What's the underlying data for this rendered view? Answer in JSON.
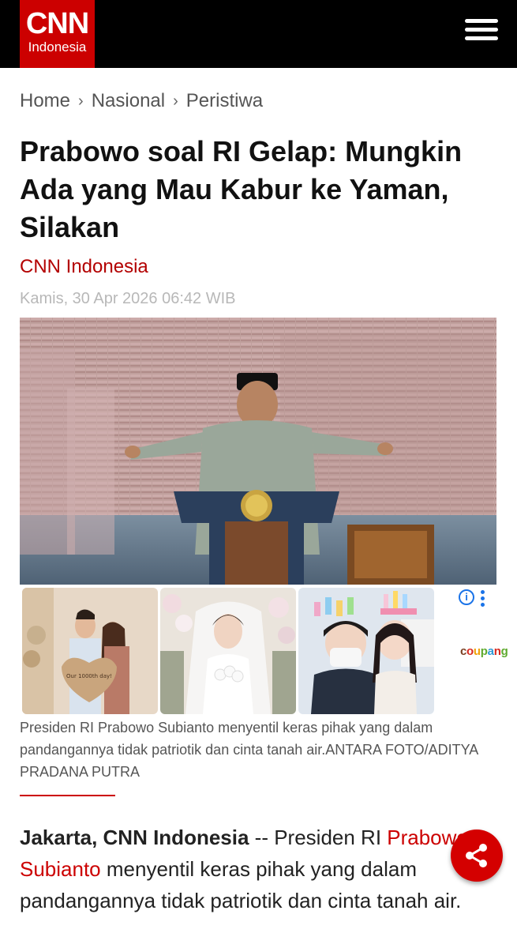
{
  "header": {
    "logo_main": "CNN",
    "logo_sub": "Indonesia",
    "menu_icon": "hamburger-menu-icon"
  },
  "breadcrumb": {
    "items": [
      "Home",
      "Nasional",
      "Peristiwa"
    ],
    "separator": "›"
  },
  "article": {
    "title": "Prabowo soal RI Gelap: Mungkin Ada yang Mau Kabur ke Yaman, Silakan",
    "author": "CNN Indonesia",
    "date": "Kamis, 30 Apr 2026 06:42 WIB",
    "caption": "Presiden RI Prabowo Subianto menyentil keras pihak yang dalam pandangannya tidak patriotik dan cinta tanah air.ANTARA FOTO/ADITYA PRADANA PUTRA",
    "lead_dateline": "Jakarta, CNN Indonesia",
    "lead_dash": " -- Presiden RI ",
    "lead_link": "Prabowo Subianto",
    "lead_rest": " menyentil keras pihak yang dalam pandangannya tidak patriotik dan cinta tanah air."
  },
  "ad": {
    "info_icon": "info-icon",
    "options_icon": "vertical-dots-icon",
    "advertiser": [
      "c",
      "o",
      "u",
      "p",
      "a",
      "n",
      "g"
    ],
    "balloon_text": "Our 1000th day!"
  },
  "share": {
    "icon": "share-icon"
  },
  "colors": {
    "brand_red": "#cc0000",
    "header_bg": "#000000",
    "link_red": "#cc0000",
    "ad_blue": "#1a73e8"
  }
}
